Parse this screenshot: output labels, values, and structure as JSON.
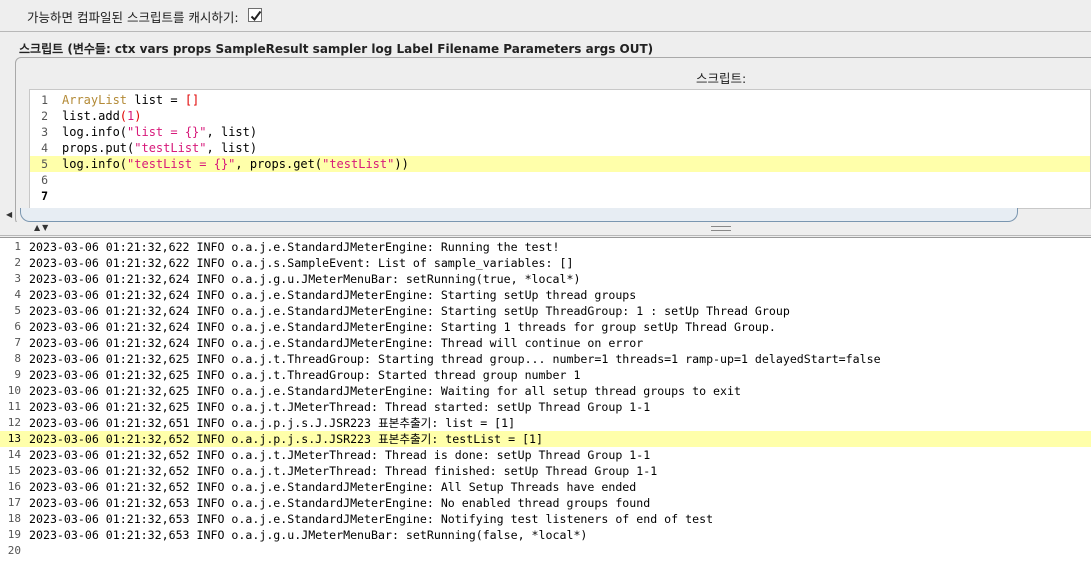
{
  "cache": {
    "label": "가능하면 컴파일된 스크립트를 캐시하기:",
    "checked": true
  },
  "script_section": {
    "header": "스크립트 (변수들: ctx vars props SampleResult sampler log Label Filename Parameters args OUT)",
    "editor_title": "스크립트:",
    "lines": [
      {
        "num": "1",
        "tokens": [
          {
            "t": "ArrayList",
            "c": "k-type"
          },
          {
            "t": " list = ",
            "c": ""
          },
          {
            "t": "[]",
            "c": "k-punct"
          }
        ]
      },
      {
        "num": "2",
        "tokens": [
          {
            "t": "list.add",
            "c": ""
          },
          {
            "t": "(",
            "c": "k-punct"
          },
          {
            "t": "1",
            "c": "k-num"
          },
          {
            "t": ")",
            "c": "k-punct"
          }
        ]
      },
      {
        "num": "3",
        "tokens": [
          {
            "t": "log.info(",
            "c": ""
          },
          {
            "t": "\"list = {}\"",
            "c": "k-str"
          },
          {
            "t": ", list)",
            "c": ""
          }
        ]
      },
      {
        "num": "4",
        "tokens": [
          {
            "t": "props.put(",
            "c": ""
          },
          {
            "t": "\"testList\"",
            "c": "k-str"
          },
          {
            "t": ", list)",
            "c": ""
          }
        ]
      },
      {
        "num": "5",
        "tokens": [
          {
            "t": "log.info(",
            "c": ""
          },
          {
            "t": "\"testList = {}\"",
            "c": "k-str"
          },
          {
            "t": ", props.get(",
            "c": ""
          },
          {
            "t": "\"testList\"",
            "c": "k-str"
          },
          {
            "t": "))",
            "c": ""
          }
        ]
      },
      {
        "num": "6",
        "tokens": []
      },
      {
        "num": "7",
        "tokens": []
      }
    ],
    "highlight_line": 5,
    "current_line": 7
  },
  "log": {
    "highlight_line": 13,
    "lines": [
      "2023-03-06 01:21:32,622 INFO o.a.j.e.StandardJMeterEngine: Running the test!",
      "2023-03-06 01:21:32,622 INFO o.a.j.s.SampleEvent: List of sample_variables: []",
      "2023-03-06 01:21:32,624 INFO o.a.j.g.u.JMeterMenuBar: setRunning(true, *local*)",
      "2023-03-06 01:21:32,624 INFO o.a.j.e.StandardJMeterEngine: Starting setUp thread groups",
      "2023-03-06 01:21:32,624 INFO o.a.j.e.StandardJMeterEngine: Starting setUp ThreadGroup: 1 : setUp Thread Group",
      "2023-03-06 01:21:32,624 INFO o.a.j.e.StandardJMeterEngine: Starting 1 threads for group setUp Thread Group.",
      "2023-03-06 01:21:32,624 INFO o.a.j.e.StandardJMeterEngine: Thread will continue on error",
      "2023-03-06 01:21:32,625 INFO o.a.j.t.ThreadGroup: Starting thread group... number=1 threads=1 ramp-up=1 delayedStart=false",
      "2023-03-06 01:21:32,625 INFO o.a.j.t.ThreadGroup: Started thread group number 1",
      "2023-03-06 01:21:32,625 INFO o.a.j.e.StandardJMeterEngine: Waiting for all setup thread groups to exit",
      "2023-03-06 01:21:32,625 INFO o.a.j.t.JMeterThread: Thread started: setUp Thread Group 1-1",
      "2023-03-06 01:21:32,651 INFO o.a.j.p.j.s.J.JSR223 표본추출기: list = [1]",
      "2023-03-06 01:21:32,652 INFO o.a.j.p.j.s.J.JSR223 표본추출기: testList = [1]",
      "2023-03-06 01:21:32,652 INFO o.a.j.t.JMeterThread: Thread is done: setUp Thread Group 1-1",
      "2023-03-06 01:21:32,652 INFO o.a.j.t.JMeterThread: Thread finished: setUp Thread Group 1-1",
      "2023-03-06 01:21:32,652 INFO o.a.j.e.StandardJMeterEngine: All Setup Threads have ended",
      "2023-03-06 01:21:32,653 INFO o.a.j.e.StandardJMeterEngine: No enabled thread groups found",
      "2023-03-06 01:21:32,653 INFO o.a.j.e.StandardJMeterEngine: Notifying test listeners of end of test",
      "2023-03-06 01:21:32,653 INFO o.a.j.g.u.JMeterMenuBar: setRunning(false, *local*)",
      ""
    ]
  },
  "icons": {
    "checkbox_check": "check-icon",
    "splitter_arrows": "collapse-arrows-icon",
    "scroll_left": "scroll-left-icon"
  }
}
